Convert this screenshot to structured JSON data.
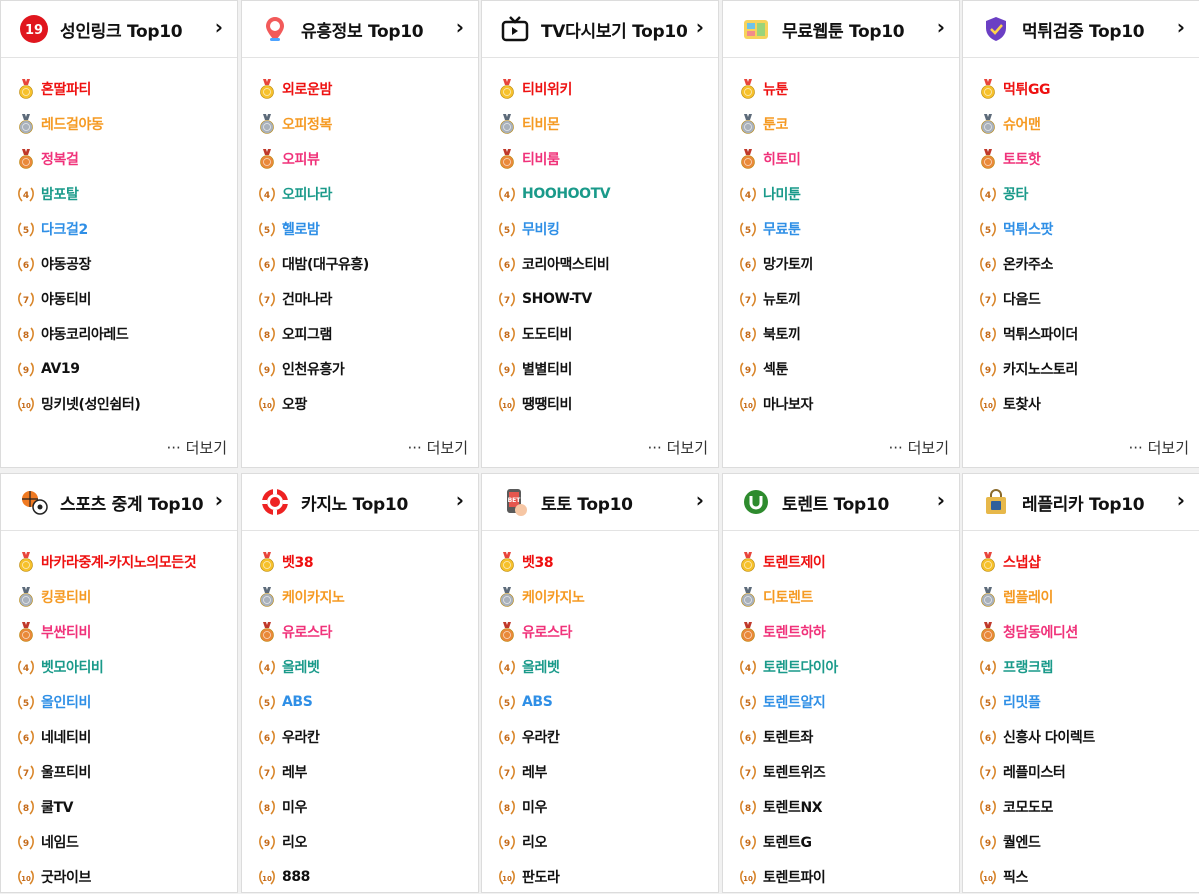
{
  "more_label": "··· 더보기",
  "colors": {
    "rank1": "#ee1111",
    "rank2": "#f59a23",
    "rank3": "#f0327a",
    "rank4": "#1a9a8a",
    "rank5": "#2f8fe6",
    "other": "#111111"
  },
  "boxes": [
    {
      "title": "성인링크 Top10",
      "icon": "adult-19-icon",
      "arrow": "›",
      "items": [
        "혼딸파티",
        "레드걸야동",
        "정복걸",
        "밤포탈",
        "다크걸2",
        "야동공장",
        "야동티비",
        "야동코리아레드",
        "AV19",
        "밍키넷(성인쉼터)"
      ]
    },
    {
      "title": "유흥정보 Top10",
      "icon": "location-pin-icon",
      "arrow": "›",
      "items": [
        "외로운밤",
        "오피정복",
        "오피뷰",
        "오피나라",
        "헬로밤",
        "대밤(대구유흥)",
        "건마나라",
        "오피그램",
        "인천유흥가",
        "오팡"
      ]
    },
    {
      "title": "TV다시보기 Top10",
      "icon": "tv-icon",
      "arrow": "›",
      "items": [
        "티비위키",
        "티비몬",
        "티비룸",
        "HOOHOOTV",
        "무비킹",
        "코리아맥스티비",
        "SHOW-TV",
        "도도티비",
        "별별티비",
        "땡땡티비"
      ]
    },
    {
      "title": "무료웹툰 Top10",
      "icon": "webtoon-icon",
      "arrow": "›",
      "items": [
        "뉴툰",
        "툰코",
        "히토미",
        "나미툰",
        "무료툰",
        "망가토끼",
        "뉴토끼",
        "북토끼",
        "섹툰",
        "마나보자"
      ]
    },
    {
      "title": "먹튀검증 Top10",
      "icon": "shield-check-icon",
      "arrow": "›",
      "items": [
        "먹튀GG",
        "슈어맨",
        "토토핫",
        "꽁타",
        "먹튀스팟",
        "온카주소",
        "다음드",
        "먹튀스파이더",
        "카지노스토리",
        "토찾사"
      ]
    },
    {
      "title": "스포츠 중계 Top10",
      "icon": "sports-balls-icon",
      "arrow": "›",
      "items": [
        "바카라중계-카지노의모든것",
        "킹콩티비",
        "부싼티비",
        "벳모아티비",
        "올인티비",
        "네네티비",
        "울프티비",
        "쿨TV",
        "네임드",
        "굿라이브"
      ]
    },
    {
      "title": "카지노 Top10",
      "icon": "casino-chip-icon",
      "arrow": "›",
      "items": [
        "벳38",
        "케이카지노",
        "유로스타",
        "올레벳",
        "ABS",
        "우라칸",
        "레부",
        "미우",
        "리오",
        "888"
      ]
    },
    {
      "title": "토토 Top10",
      "icon": "bet-phone-icon",
      "arrow": "›",
      "items": [
        "벳38",
        "케이카지노",
        "유로스타",
        "올레벳",
        "ABS",
        "우라칸",
        "레부",
        "미우",
        "리오",
        "판도라"
      ]
    },
    {
      "title": "토렌트 Top10",
      "icon": "utorrent-icon",
      "arrow": "›",
      "items": [
        "토렌트제이",
        "디토렌트",
        "토렌트하하",
        "토렌트다이아",
        "토렌트알지",
        "토렌트좌",
        "토렌트위즈",
        "토렌트NX",
        "토렌트G",
        "토렌트파이"
      ]
    },
    {
      "title": "레플리카 Top10",
      "icon": "shopping-bag-icon",
      "arrow": "›",
      "items": [
        "스냅샵",
        "렙플레이",
        "청담동에디션",
        "프랭크렙",
        "리밋플",
        "신흥사 다이렉트",
        "레플미스터",
        "코모도모",
        "퀄엔드",
        "픽스"
      ]
    }
  ]
}
